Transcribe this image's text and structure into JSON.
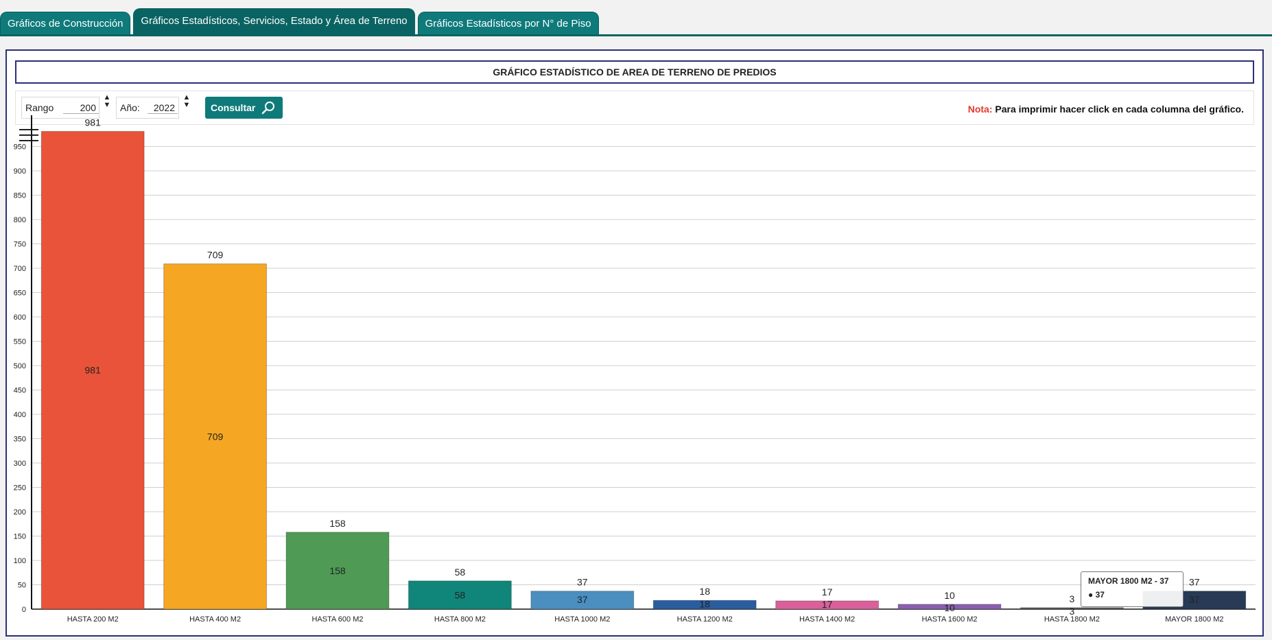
{
  "tabs": [
    {
      "label": "Gráficos de Construcción"
    },
    {
      "label": "Gráficos Estadísticos, Servicios, Estado y Área de Terreno"
    },
    {
      "label": "Gráficos Estadísticos por N° de Piso"
    }
  ],
  "panel": {
    "title": "GRÁFICO ESTADÍSTICO DE AREA DE TERRENO DE PREDIOS"
  },
  "filters": {
    "rango_label": "Rango",
    "rango_value": "200",
    "anio_label": "Año:",
    "anio_value": "2022",
    "consultar_label": "Consultar",
    "nota_prefix": "Nota:",
    "nota_text": " Para imprimir hacer click en cada columna del gráfico."
  },
  "tooltip": {
    "title": "MAYOR 1800 M2 - 37",
    "value": "37"
  },
  "chart_data": {
    "type": "bar",
    "categories": [
      "HASTA 200 M2",
      "HASTA 400 M2",
      "HASTA 600 M2",
      "HASTA 800 M2",
      "HASTA 1000 M2",
      "HASTA 1200 M2",
      "HASTA 1400 M2",
      "HASTA 1600 M2",
      "HASTA 1800 M2",
      "MAYOR 1800 M2"
    ],
    "values": [
      981,
      709,
      158,
      58,
      37,
      18,
      17,
      10,
      3,
      37
    ],
    "colors": [
      "#e8533a",
      "#f5a623",
      "#4f9a55",
      "#10857a",
      "#4a8fc0",
      "#2a5d9f",
      "#d9609a",
      "#8a5fb0",
      "#5a5a5a",
      "#283a55"
    ],
    "ylim": [
      0,
      1000
    ],
    "yticks": [
      0,
      50,
      100,
      150,
      200,
      250,
      300,
      350,
      400,
      450,
      500,
      550,
      600,
      650,
      700,
      750,
      800,
      850,
      900,
      950
    ],
    "show_value_labels": true,
    "grid": true
  }
}
